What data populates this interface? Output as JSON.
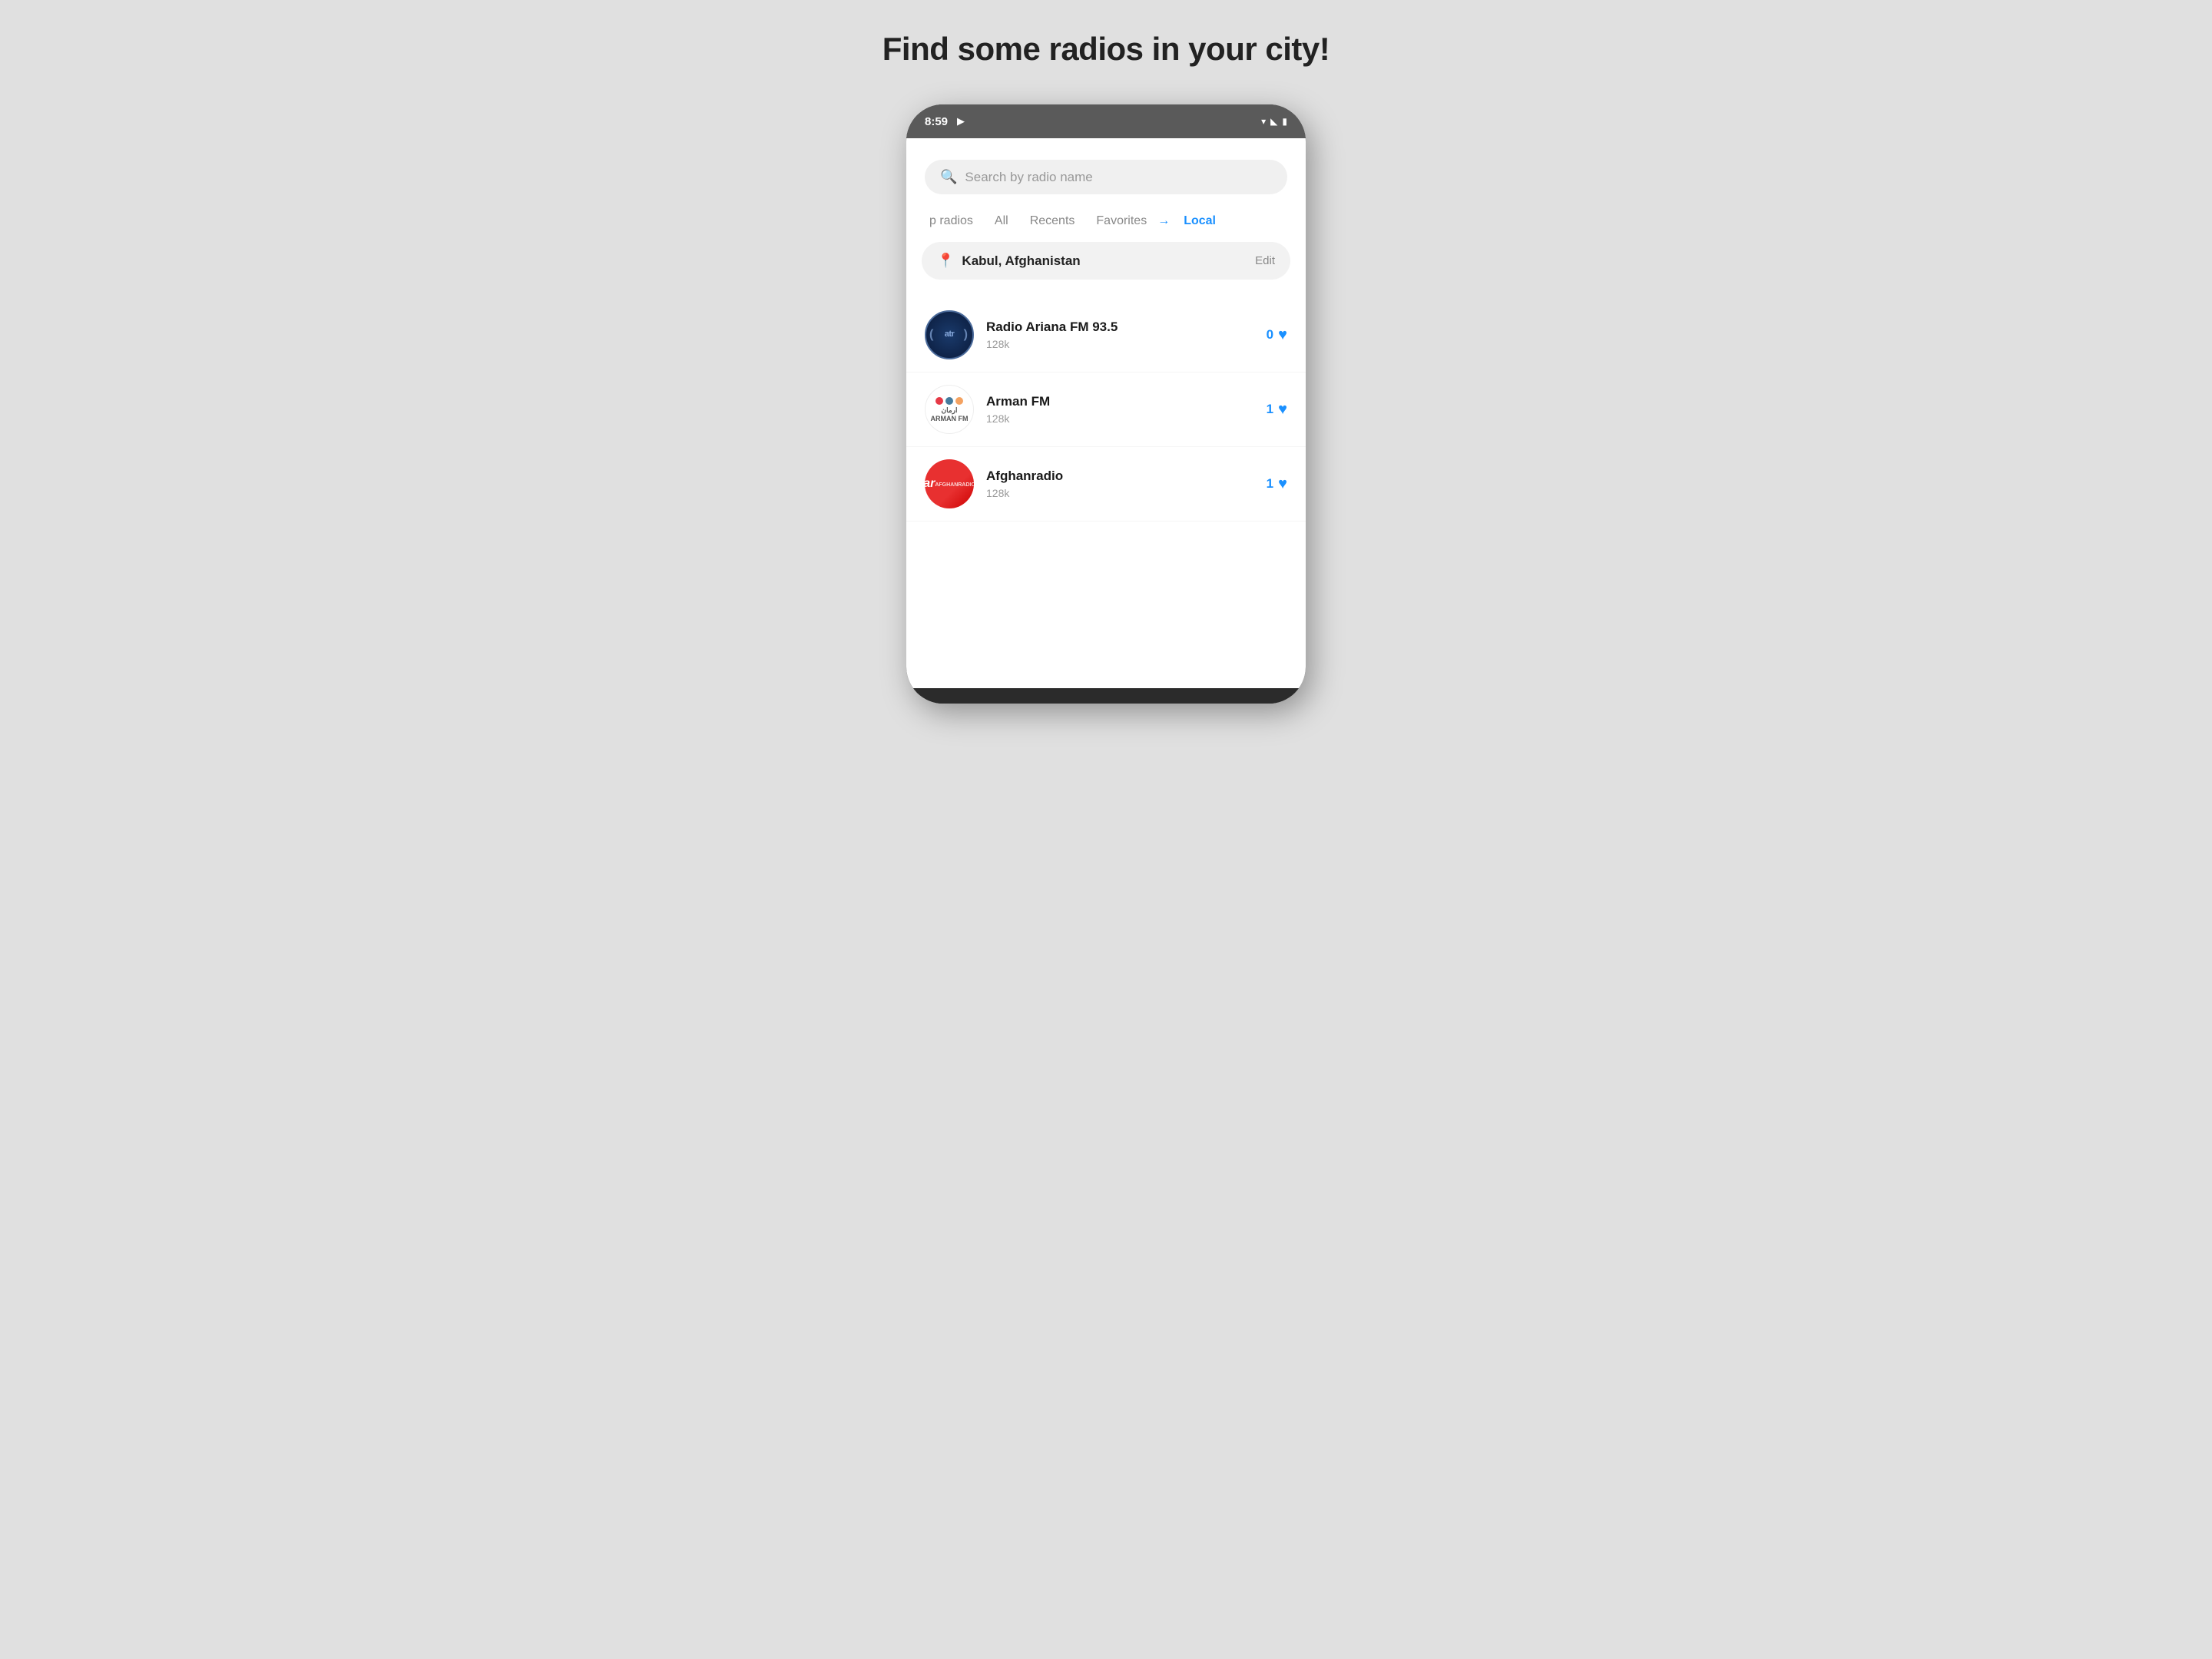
{
  "page": {
    "title": "Find some radios in your city!",
    "background_color": "#e0e0e0"
  },
  "status_bar": {
    "time": "8:59",
    "play_icon": "▶",
    "wifi_icon": "▾",
    "signal_icon": "▾",
    "battery_icon": "▮"
  },
  "search": {
    "placeholder": "Search by radio name"
  },
  "filter_tabs": [
    {
      "label": "p radios",
      "active": false
    },
    {
      "label": "All",
      "active": false
    },
    {
      "label": "Recents",
      "active": false
    },
    {
      "label": "Favorites",
      "active": false
    },
    {
      "label": "Local",
      "active": true
    }
  ],
  "location": {
    "name": "Kabul, Afghanistan",
    "edit_label": "Edit"
  },
  "radio_stations": [
    {
      "name": "Radio Ariana FM 93.5",
      "bitrate": "128k",
      "likes": 0,
      "logo_type": "ariana"
    },
    {
      "name": "Arman FM",
      "bitrate": "128k",
      "likes": 1,
      "logo_type": "arman"
    },
    {
      "name": "Afghanradio",
      "bitrate": "128k",
      "likes": 1,
      "logo_type": "afghan"
    }
  ]
}
